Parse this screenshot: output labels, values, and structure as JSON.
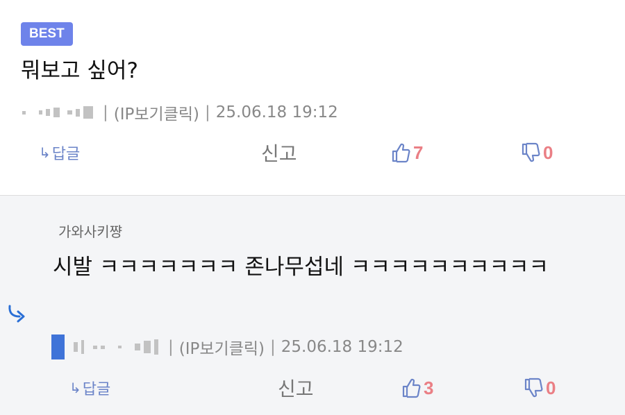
{
  "comment1": {
    "badge": "BEST",
    "text": "뭐보고 싶어?",
    "meta": {
      "ip_label": "(IP보기클릭)",
      "timestamp": "25.06.18 19:12"
    },
    "actions": {
      "reply": "답글",
      "report": "신고",
      "likes": "7",
      "dislikes": "0"
    }
  },
  "comment2": {
    "author": "가와사키쨩",
    "text": "시발 ㅋㅋㅋㅋㅋㅋㅋ  존나무섭네 ㅋㅋㅋㅋㅋㅋㅋㅋㅋㅋ",
    "meta": {
      "ip_label": "(IP보기클릭)",
      "timestamp": "25.06.18 19:12"
    },
    "actions": {
      "reply": "답글",
      "report": "신고",
      "likes": "3",
      "dislikes": "0"
    }
  },
  "colors": {
    "badge": "#6e83ea",
    "reply_link": "#6b84c8",
    "count": "#ea7f85",
    "thumb_icon": "#6b84c8",
    "reply_bg": "#f4f5f7"
  },
  "icons": {
    "reply_arrow": "reply-arrow-icon",
    "thumb_up": "thumbs-up-icon",
    "thumb_down": "thumbs-down-icon",
    "reply_indicator": "reply-indicator-icon"
  }
}
